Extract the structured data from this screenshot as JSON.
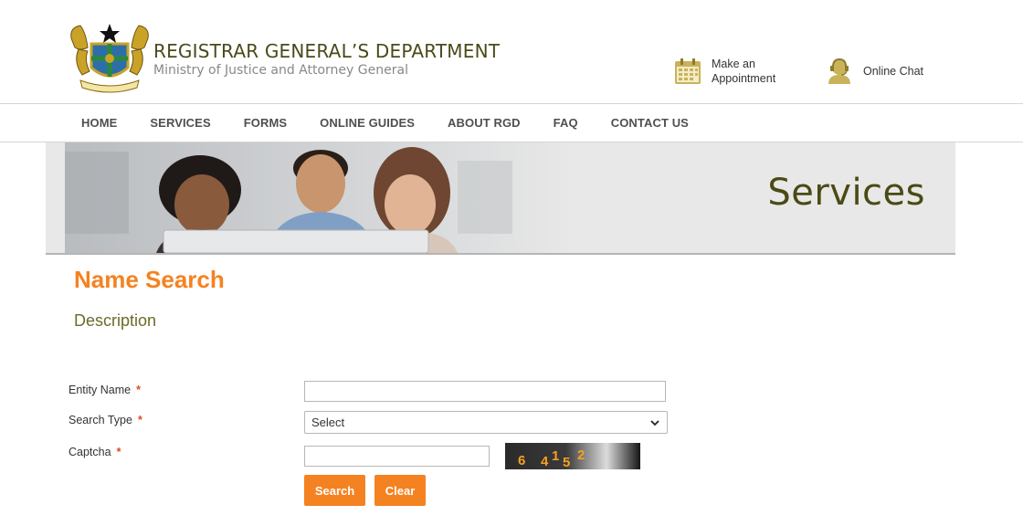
{
  "header": {
    "org_title": "REGISTRAR GENERAL’S DEPARTMENT",
    "org_subtitle": "Ministry of Justice and Attorney General",
    "appointment_label": "Make an Appointment",
    "chat_label": "Online Chat"
  },
  "nav": {
    "items": [
      "HOME",
      "SERVICES",
      "FORMS",
      "ONLINE GUIDES",
      "ABOUT RGD",
      "FAQ",
      "CONTACT US"
    ]
  },
  "banner": {
    "title": "Services"
  },
  "main": {
    "page_title": "Name Search",
    "description": "Description"
  },
  "form": {
    "entity_label": "Entity Name",
    "search_type_label": "Search Type",
    "captcha_label": "Captcha",
    "required_marker": "*",
    "entity_value": "",
    "search_type_selected": "Select",
    "captcha_value": "",
    "captcha_text": [
      "6",
      "4",
      "1",
      "5",
      "2"
    ],
    "search_button": "Search",
    "clear_button": "Clear"
  },
  "colors": {
    "accent": "#f58220",
    "title_olive": "#4a4a14",
    "required": "#e04a1f"
  },
  "icons": {
    "emblem": "coat-of-arms",
    "appointment": "calendar-icon",
    "chat": "support-agent-icon",
    "select": "chevron-down-icon"
  }
}
